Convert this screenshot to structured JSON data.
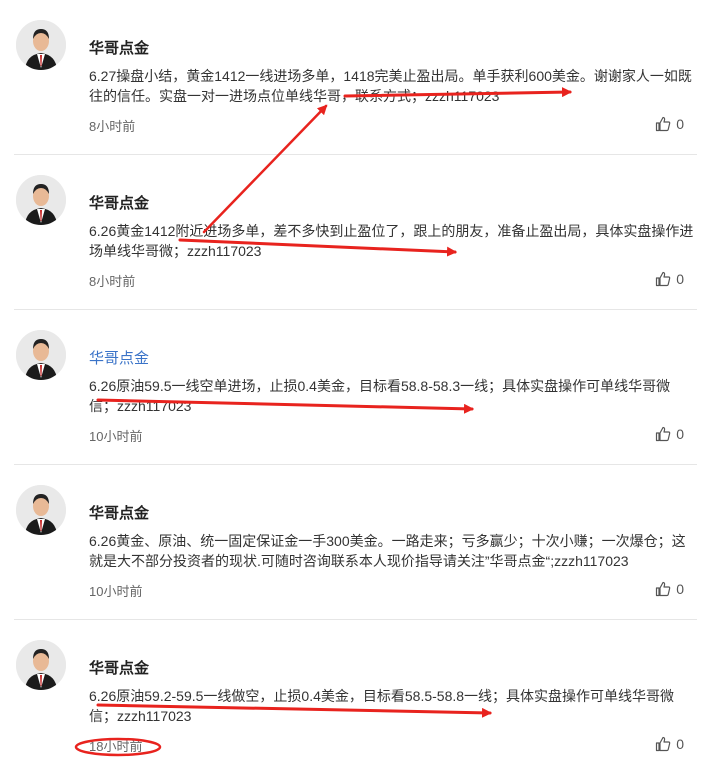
{
  "posts": [
    {
      "author": "华哥点金",
      "author_is_link": false,
      "content": "6.27操盘小结，黄金1412一线进场多单，1418完美止盈出局。单手获利600美金。谢谢家人一如既往的信任。实盘一对一进场点位单线华哥，联系方式；zzzh117023",
      "time": "8小时前",
      "likes": "0"
    },
    {
      "author": "华哥点金",
      "author_is_link": false,
      "content": "6.26黄金1412附近进场多单，差不多快到止盈位了，跟上的朋友，准备止盈出局，具体实盘操作进场单线华哥微；zzzh117023",
      "time": "8小时前",
      "likes": "0"
    },
    {
      "author": "华哥点金",
      "author_is_link": true,
      "content": "6.26原油59.5一线空单进场，止损0.4美金，目标看58.8-58.3一线；具体实盘操作可单线华哥微信；zzzh117023",
      "time": "10小时前",
      "likes": "0"
    },
    {
      "author": "华哥点金",
      "author_is_link": false,
      "content": "6.26黄金、原油、统一固定保证金一手300美金。一路走来；亏多赢少；十次小赚；一次爆仓；这就是大不部分投资者的现状.可随时咨询联系本人现价指导请关注”华哥点金“;zzzh117023",
      "time": "10小时前",
      "likes": "0"
    },
    {
      "author": "华哥点金",
      "author_is_link": false,
      "content": "6.26原油59.2-59.5一线做空，止损0.4美金，目标看58.5-58.8一线；具体实盘操作可单线华哥微信；zzzh117023",
      "time": "18小时前",
      "likes": "0"
    }
  ],
  "annotation_color": "#e8231e"
}
